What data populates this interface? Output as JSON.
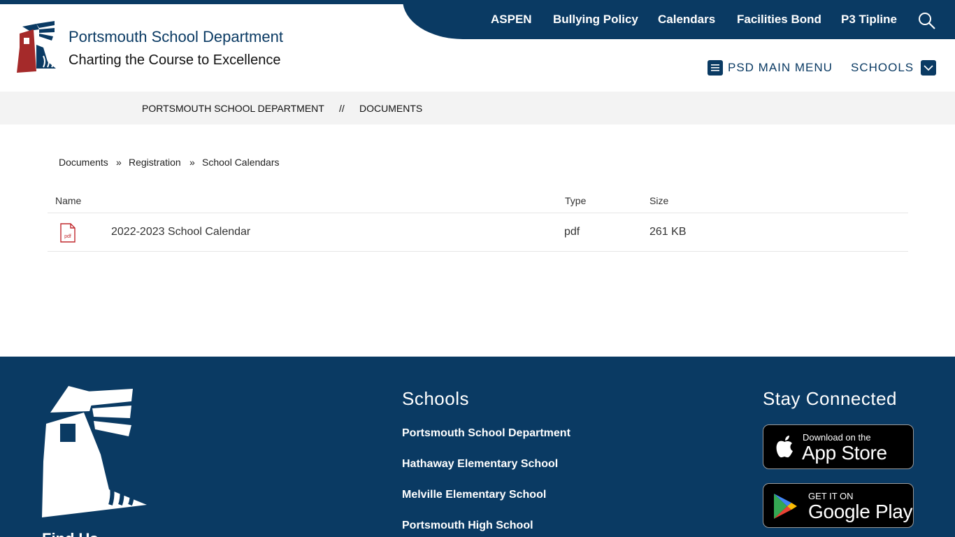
{
  "header": {
    "site_title": "Portsmouth School Department",
    "tagline": "Charting the Course to Excellence",
    "top_nav": [
      "ASPEN",
      "Bullying Policy",
      "Calendars",
      "Facilities Bond",
      "P3 Tipline"
    ],
    "main_menu_label": "PSD MAIN MENU",
    "schools_label": "SCHOOLS"
  },
  "breadcrumb": {
    "home": "PORTSMOUTH SCHOOL DEPARTMENT",
    "separator": "//",
    "current": "DOCUMENTS"
  },
  "folder_path": {
    "items": [
      "Documents",
      "Registration",
      "School Calendars"
    ],
    "separator": "»"
  },
  "table": {
    "headers": {
      "name": "Name",
      "type": "Type",
      "size": "Size"
    },
    "rows": [
      {
        "icon": "pdf-file-icon",
        "icon_label": "pdf",
        "name": "2022-2023 School Calendar",
        "type": "pdf",
        "size": "261 KB"
      }
    ]
  },
  "footer": {
    "schools_heading": "Schools",
    "schools": [
      "Portsmouth School Department",
      "Hathaway Elementary School",
      "Melville Elementary School",
      "Portsmouth High School"
    ],
    "stay_connected_heading": "Stay Connected",
    "app_store": {
      "small": "Download on the",
      "big": "App Store"
    },
    "google_play": {
      "small": "GET IT ON",
      "big": "Google Play"
    },
    "cutoff_text": "Find Us"
  },
  "colors": {
    "primary": "#0a3a63",
    "accent_red": "#a52a2a",
    "band": "#f3f3f3"
  }
}
